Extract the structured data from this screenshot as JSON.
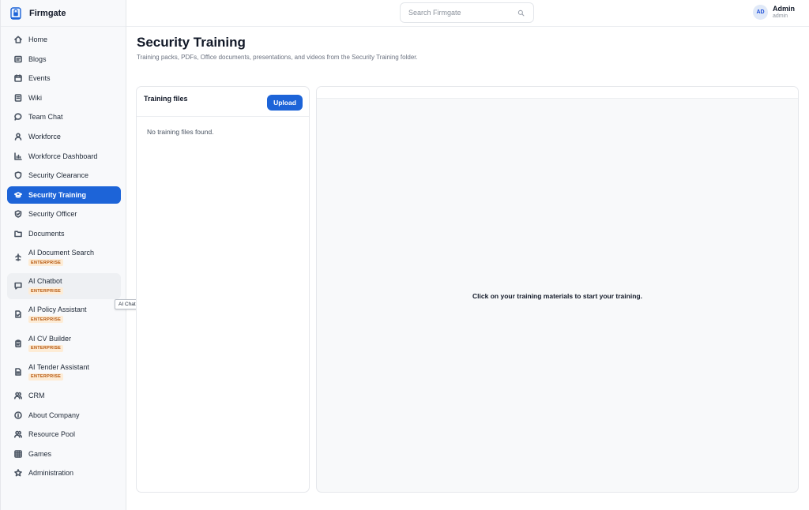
{
  "app": {
    "name": "Firmgate"
  },
  "search": {
    "placeholder": "Search Firmgate"
  },
  "user": {
    "initials": "AD",
    "name": "Admin",
    "role": "admin"
  },
  "sidebar": {
    "items": [
      {
        "label": "Home",
        "icon": "home-icon"
      },
      {
        "label": "Blogs",
        "icon": "blog-icon"
      },
      {
        "label": "Events",
        "icon": "calendar-icon"
      },
      {
        "label": "Wiki",
        "icon": "book-icon"
      },
      {
        "label": "Team Chat",
        "icon": "chat-bubble-icon"
      },
      {
        "label": "Workforce",
        "icon": "user-icon"
      },
      {
        "label": "Workforce Dashboard",
        "icon": "bar-chart-icon"
      },
      {
        "label": "Security Clearance",
        "icon": "shield-icon"
      },
      {
        "label": "Security Training",
        "icon": "graduation-cap-icon",
        "active": true
      },
      {
        "label": "Security Officer",
        "icon": "shield-check-icon"
      },
      {
        "label": "Documents",
        "icon": "folder-icon"
      },
      {
        "label": "AI Document Search",
        "icon": "sparkle-icon",
        "badge": "ENTERPRISE"
      },
      {
        "label": "AI Chatbot",
        "icon": "message-icon",
        "badge": "ENTERPRISE"
      },
      {
        "label": "AI Policy Assistant",
        "icon": "document-check-icon",
        "badge": "ENTERPRISE"
      },
      {
        "label": "AI CV Builder",
        "icon": "clipboard-icon",
        "badge": "ENTERPRISE"
      },
      {
        "label": "AI Tender Assistant",
        "icon": "document-icon",
        "badge": "ENTERPRISE"
      },
      {
        "label": "CRM",
        "icon": "users-icon"
      },
      {
        "label": "About Company",
        "icon": "info-icon"
      },
      {
        "label": "Resource Pool",
        "icon": "users-group-icon"
      },
      {
        "label": "Games",
        "icon": "grid-icon"
      },
      {
        "label": "Administration",
        "icon": "star-icon"
      }
    ]
  },
  "tooltip": {
    "text": "AI Chatbot — Enterprise feature"
  },
  "page": {
    "title": "Security Training",
    "subtitle": "Training packs, PDFs, Office documents, presentations, and videos from the Security Training folder."
  },
  "files_panel": {
    "title": "Training files",
    "upload_label": "Upload",
    "empty_text": "No training files found."
  },
  "viewer": {
    "message": "Click on your training materials to start your training."
  },
  "colors": {
    "accent": "#1d64d8",
    "badge_text": "#b45309",
    "badge_bg": "#fdecd6",
    "sidebar_bg": "#f8f9fb"
  }
}
